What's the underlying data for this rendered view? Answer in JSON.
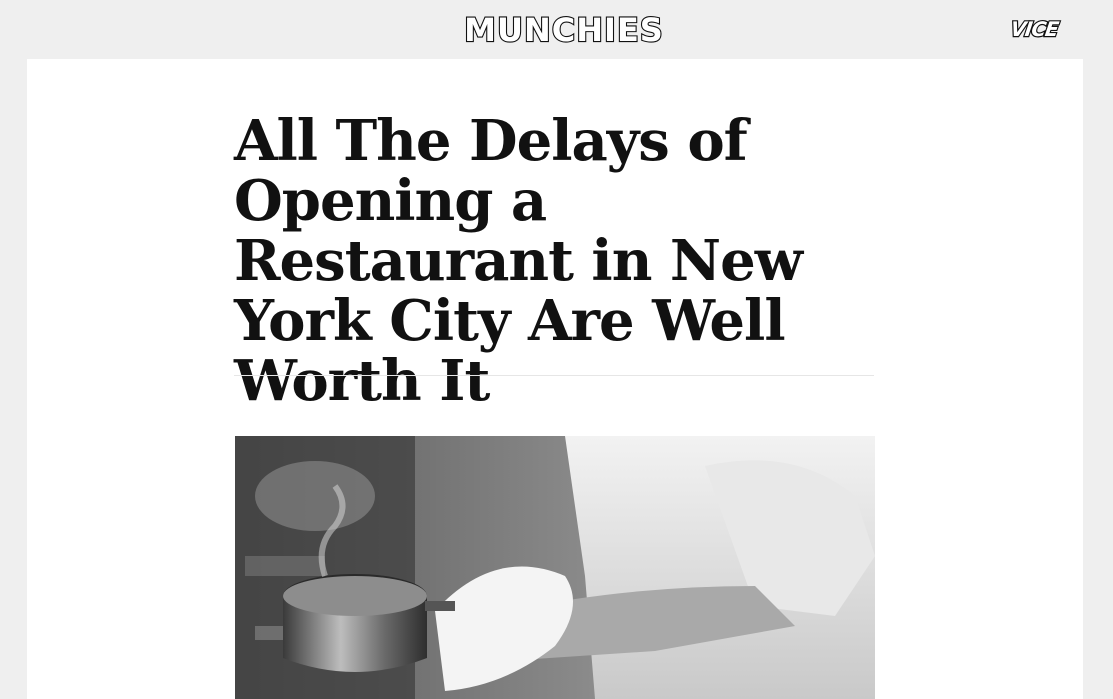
{
  "header": {
    "site_logo_text": "MUNCHIES",
    "network_logo_text": "VICE"
  },
  "article": {
    "headline": "All The Delays of Opening a Restaurant in New York City Are Well Worth It",
    "hero_image_alt": "Black-and-white photo of a chef holding a steaming pot with a towel"
  }
}
